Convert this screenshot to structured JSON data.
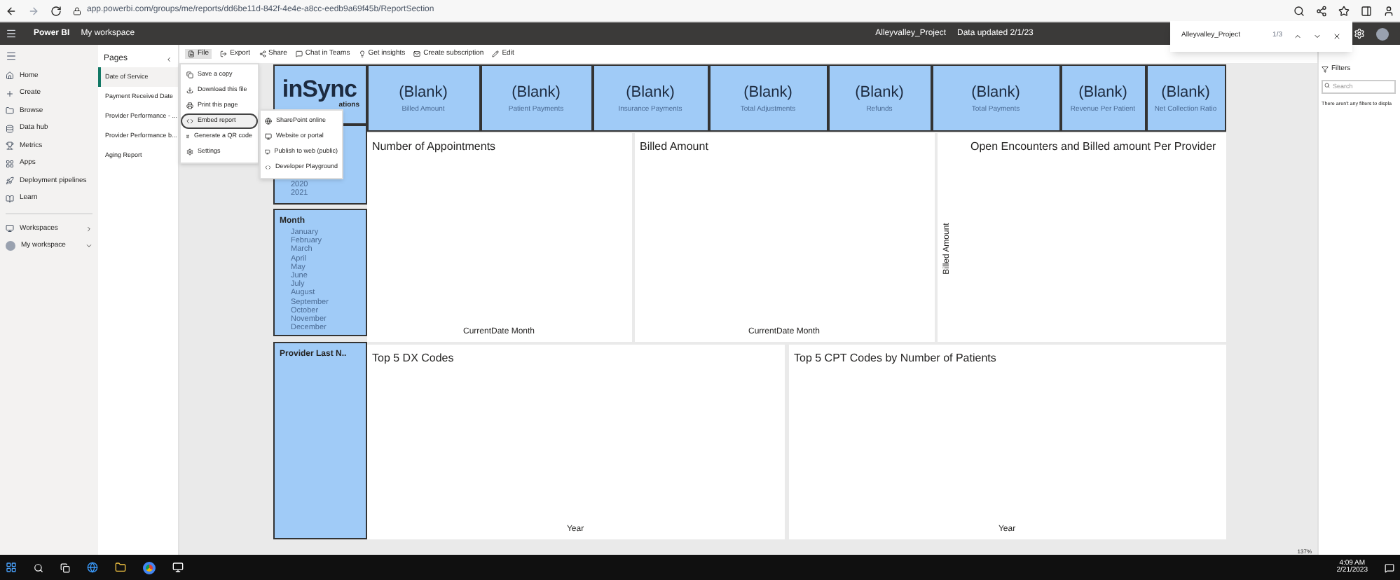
{
  "browser": {
    "url": "app.powerbi.com/groups/me/reports/dd6be11d-842f-4e4e-a8cc-eedb9a69f45b/ReportSection"
  },
  "header": {
    "app": "Power BI",
    "workspace": "My workspace",
    "report": "Alleyvalley_Project",
    "updated": "Data updated 2/1/23"
  },
  "find_bar": {
    "query": "Alleyvalley_Project",
    "count": "1/3"
  },
  "nav": {
    "items": [
      {
        "label": "Home"
      },
      {
        "label": "Create"
      },
      {
        "label": "Browse"
      },
      {
        "label": "Data hub"
      },
      {
        "label": "Metrics"
      },
      {
        "label": "Apps"
      },
      {
        "label": "Deployment pipelines"
      },
      {
        "label": "Learn"
      }
    ],
    "workspaces": [
      {
        "label": "Workspaces"
      },
      {
        "label": "My workspace"
      }
    ]
  },
  "pages": {
    "title": "Pages",
    "items": [
      {
        "label": "Date of Service",
        "selected": true
      },
      {
        "label": "Payment Received Date",
        "selected": false
      },
      {
        "label": "Provider Performance - ...",
        "selected": false
      },
      {
        "label": "Provider Performance b...",
        "selected": false
      },
      {
        "label": "Aging Report",
        "selected": false
      }
    ]
  },
  "toolbar": {
    "items": [
      {
        "label": "File"
      },
      {
        "label": "Export"
      },
      {
        "label": "Share"
      },
      {
        "label": "Chat in Teams"
      },
      {
        "label": "Get insights"
      },
      {
        "label": "Create subscription"
      },
      {
        "label": "Edit"
      }
    ]
  },
  "file_menu": {
    "items": [
      {
        "label": "Save a copy",
        "selected": false
      },
      {
        "label": "Download this file",
        "selected": false
      },
      {
        "label": "Print this page",
        "selected": false
      },
      {
        "label": "Embed report",
        "selected": true
      },
      {
        "label": "Generate a QR code",
        "selected": false
      },
      {
        "label": "Settings",
        "selected": false
      }
    ]
  },
  "embed_menu": {
    "items": [
      {
        "label": "SharePoint online"
      },
      {
        "label": "Website or portal"
      },
      {
        "label": "Publish to web (public)"
      },
      {
        "label": "Developer Playground"
      }
    ]
  },
  "logo": {
    "text": "inSync",
    "caption": "ations"
  },
  "slicers": [
    {
      "items": [
        "2020",
        "2021"
      ]
    },
    {
      "title": "Month",
      "items": [
        "January",
        "February",
        "March",
        "April",
        "May",
        "June",
        "July",
        "August",
        "September",
        "October",
        "November",
        "December"
      ]
    },
    {
      "title": "Provider Last N.."
    }
  ],
  "cards": [
    {
      "value": "(Blank)",
      "label": "Billed Amount"
    },
    {
      "value": "(Blank)",
      "label": "Patient Payments"
    },
    {
      "value": "(Blank)",
      "label": "Insurance Payments"
    },
    {
      "value": "(Blank)",
      "label": "Total Adjustments"
    },
    {
      "value": "(Blank)",
      "label": "Refunds"
    },
    {
      "value": "(Blank)",
      "label": "Total Payments"
    },
    {
      "value": "(Blank)",
      "label": "Revenue Per Patient"
    },
    {
      "value": "(Blank)",
      "label": "Net Collection Ratio"
    }
  ],
  "charts": [
    {
      "title": "Number of Appointments",
      "xlabel": "CurrentDate Month"
    },
    {
      "title": "Billed Amount",
      "xlabel": "CurrentDate Month"
    },
    {
      "title": "Open Encounters and Billed amount Per Provider",
      "ylabel": "Billed Amount"
    },
    {
      "title": "Top 5 DX Codes",
      "xlabel": "Year"
    },
    {
      "title": "Top 5 CPT Codes by Number of Patients",
      "xlabel": "Year"
    }
  ],
  "filters": {
    "title": "Filters",
    "placeholder": "Search",
    "empty": "There aren't any filters to displa"
  },
  "zoom": "137%",
  "taskbar": {
    "time": "4:09 AM",
    "date": "2/21/2023"
  }
}
